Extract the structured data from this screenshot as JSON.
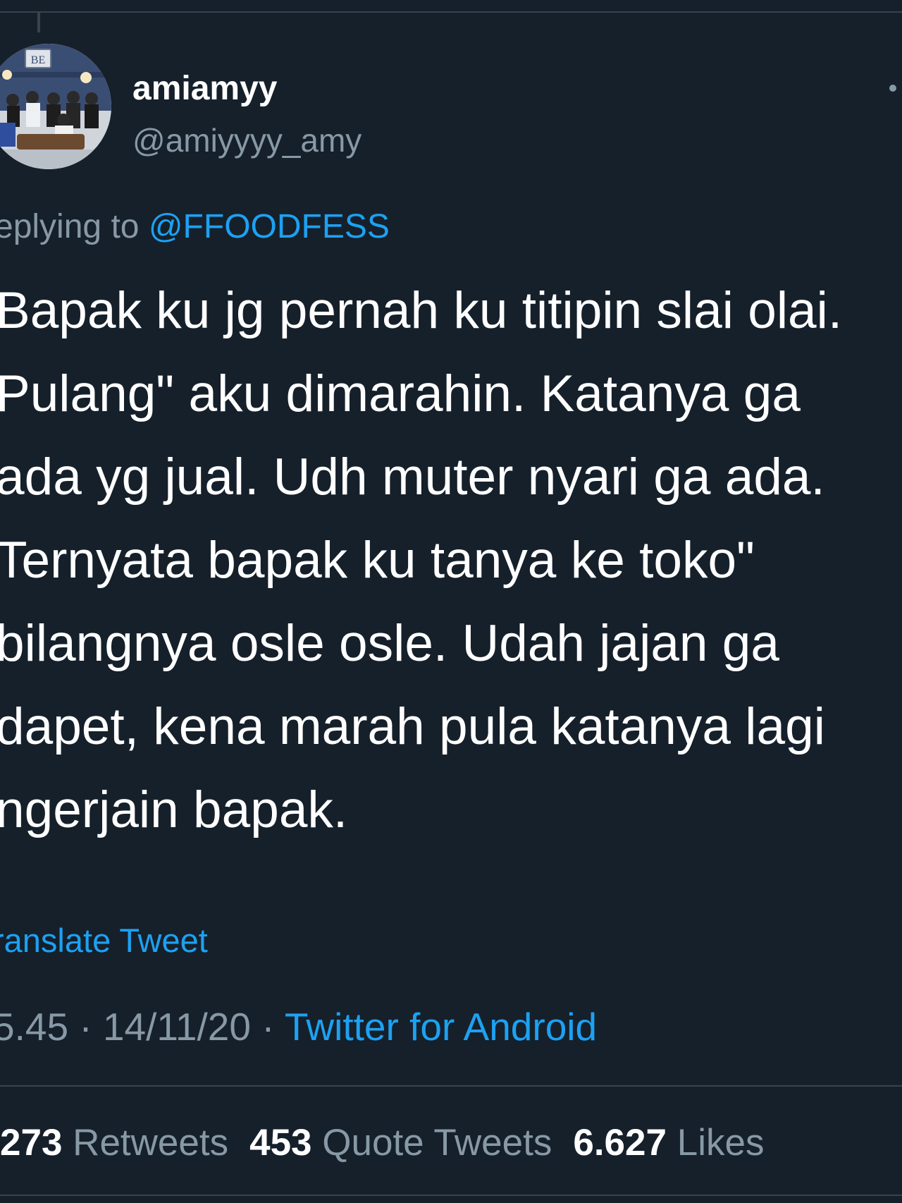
{
  "user": {
    "display_name": "amiamyy",
    "handle": "@amiyyyy_amy",
    "avatar_sign_text": "BE"
  },
  "reply": {
    "prefix": "eplying to",
    "mention": "@FFOODFESS"
  },
  "tweet": {
    "lines": [
      "Bapak ku jg pernah ku titipin slai olai.",
      "Pulang\" aku dimarahin. Katanya ga",
      "ada yg jual. Udh muter nyari ga ada.",
      "Ternyata bapak ku tanya ke toko\"",
      "bilangnya osle osle. Udah jajan ga",
      "dapet, kena marah pula katanya lagi",
      "ngerjain bapak."
    ]
  },
  "translate_label": "ranslate Tweet",
  "meta": {
    "time": "5.45",
    "separator": "·",
    "date": "14/11/20",
    "source": "Twitter for Android"
  },
  "stats": {
    "retweets_count": "273",
    "retweets_label": "Retweets",
    "quotes_count": "453",
    "quotes_label": "Quote Tweets",
    "likes_count": "6.627",
    "likes_label": "Likes"
  },
  "colors": {
    "background": "#15202b",
    "accent": "#1da1f2",
    "secondary_text": "#8899a6",
    "divider": "#38444d"
  }
}
